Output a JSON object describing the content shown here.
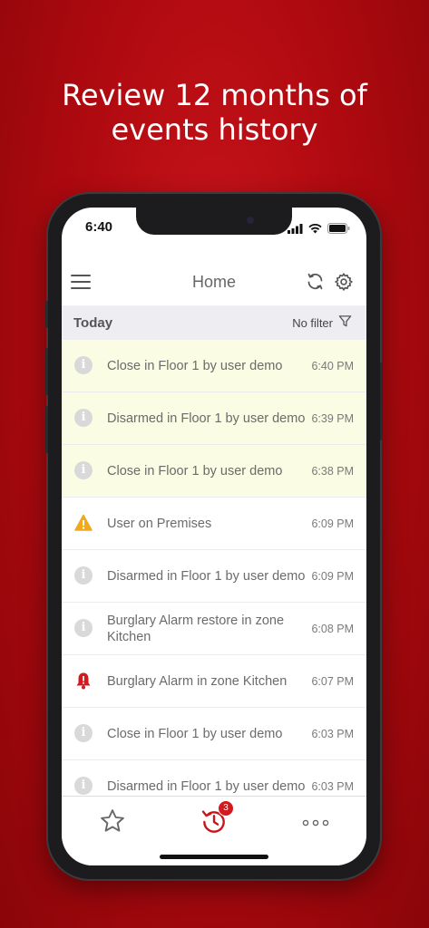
{
  "headline": {
    "line1": "Review 12 months of",
    "line2": "events history"
  },
  "status_bar": {
    "time": "6:40"
  },
  "navbar": {
    "title": "Home"
  },
  "section": {
    "title": "Today",
    "filter_label": "No filter"
  },
  "events": [
    {
      "message": "Close in Floor 1 by user demo",
      "time": "6:40 PM",
      "icon": "info-icon",
      "highlighted": true
    },
    {
      "message": "Disarmed in Floor 1 by user demo",
      "time": "6:39 PM",
      "icon": "info-icon",
      "highlighted": true
    },
    {
      "message": "Close in Floor 1 by user demo",
      "time": "6:38 PM",
      "icon": "info-icon",
      "highlighted": true
    },
    {
      "message": "User on Premises",
      "time": "6:09 PM",
      "icon": "warning-icon",
      "highlighted": false
    },
    {
      "message": "Disarmed in Floor 1 by user demo",
      "time": "6:09 PM",
      "icon": "info-icon",
      "highlighted": false
    },
    {
      "message": "Burglary Alarm restore in zone Kitchen",
      "time": "6:08 PM",
      "icon": "info-icon",
      "highlighted": false
    },
    {
      "message": "Burglary Alarm in zone Kitchen",
      "time": "6:07 PM",
      "icon": "alarm-bell-icon",
      "highlighted": false
    },
    {
      "message": "Close in Floor 1 by user demo",
      "time": "6:03 PM",
      "icon": "info-icon",
      "highlighted": false
    },
    {
      "message": "Disarmed in Floor 1 by user demo",
      "time": "6:03 PM",
      "icon": "info-icon",
      "highlighted": false
    }
  ],
  "tabbar": {
    "history_badge": "3"
  },
  "colors": {
    "brand_red": "#c8151b",
    "highlight": "#fafce3",
    "warning": "#f0a81c",
    "alarm": "#d21a1f"
  }
}
